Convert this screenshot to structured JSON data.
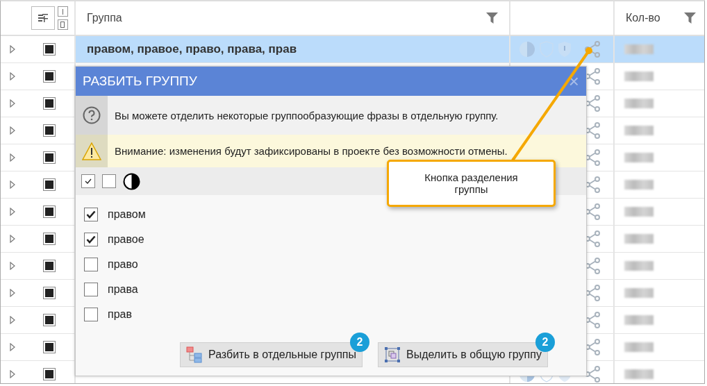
{
  "table": {
    "columns": [
      {
        "title": "Группа"
      },
      {
        "title": "Кол-во"
      }
    ],
    "rows": [
      {
        "group": "правом, правое, право, права, прав",
        "selected": true,
        "checked": true
      },
      {
        "selected": false,
        "checked": true
      },
      {
        "selected": false,
        "checked": true
      },
      {
        "selected": false,
        "checked": true
      },
      {
        "selected": false,
        "checked": true
      },
      {
        "selected": false,
        "checked": true
      },
      {
        "selected": false,
        "checked": true
      },
      {
        "selected": false,
        "checked": true
      },
      {
        "selected": false,
        "checked": true
      },
      {
        "selected": false,
        "checked": true
      },
      {
        "selected": false,
        "checked": true
      },
      {
        "selected": false,
        "checked": true
      },
      {
        "selected": false,
        "checked": true
      }
    ]
  },
  "dialog": {
    "title": "РАЗБИТЬ ГРУППУ",
    "close": "×",
    "info": "Вы можете отделить некоторые группообразующие фразы в отдельную группу.",
    "warning": "Внимание: изменения будут зафиксированы в проекте без возможности отмены.",
    "items": [
      {
        "label": "правом",
        "checked": true
      },
      {
        "label": "правое",
        "checked": true
      },
      {
        "label": "право",
        "checked": false
      },
      {
        "label": "права",
        "checked": false
      },
      {
        "label": "прав",
        "checked": false
      }
    ],
    "buttons": [
      {
        "kind": "split",
        "label": "Разбить в отдельные группы",
        "badge": "2"
      },
      {
        "kind": "merge",
        "label": "Выделить в общую группу",
        "badge": "2"
      }
    ]
  },
  "callout": {
    "text": "Кнопка разделения группы"
  }
}
